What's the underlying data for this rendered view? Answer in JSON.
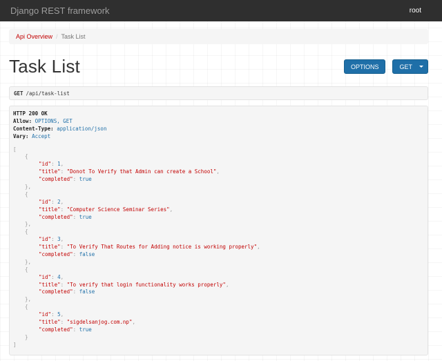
{
  "navbar": {
    "brand": "Django REST framework",
    "user": "root"
  },
  "breadcrumb": {
    "items": [
      "Api Overview",
      "Task List"
    ],
    "separator": "/"
  },
  "page": {
    "title": "Task List"
  },
  "buttons": {
    "options": "OPTIONS",
    "get": "GET"
  },
  "request": {
    "method": "GET",
    "path": "/api/task-list"
  },
  "response": {
    "status": "HTTP 200 OK",
    "headers": [
      {
        "key": "Allow:",
        "value": "OPTIONS, GET"
      },
      {
        "key": "Content-Type:",
        "value": "application/json"
      },
      {
        "key": "Vary:",
        "value": "Accept"
      }
    ],
    "tasks": [
      {
        "id": "1",
        "title": "\"Donot To Verify that Admin can create a School\"",
        "completed": "true"
      },
      {
        "id": "2",
        "title": "\"Computer Science Seminar Series\"",
        "completed": "true"
      },
      {
        "id": "3",
        "title": "\"To Verify That Routes for Adding notice is working properly\"",
        "completed": "false"
      },
      {
        "id": "4",
        "title": "\"To verify that login functionality works properly\"",
        "completed": "false"
      },
      {
        "id": "5",
        "title": "\"sigdelsanjog.com.np\"",
        "completed": "true"
      }
    ],
    "json_keys": {
      "id": "\"id\"",
      "title": "\"title\"",
      "completed": "\"completed\""
    },
    "punctuation": {
      "open_array": "[",
      "close_array": "]",
      "open_obj": "{",
      "close_obj": "}",
      "close_obj_comma": "},",
      "colon": ": ",
      "comma": ","
    }
  },
  "colors": {
    "navbar_bg": "#2f2f2f",
    "link_red": "#c20000",
    "button_blue": "#1f6fa8",
    "panel_bg": "#f5f5f5"
  }
}
